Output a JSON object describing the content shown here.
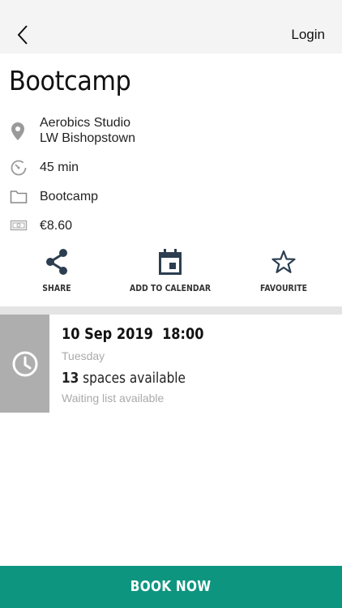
{
  "header": {
    "back_icon": "chevron-left-icon",
    "login_label": "Login"
  },
  "class": {
    "title": "Bootcamp",
    "location_line1": "Aerobics Studio",
    "location_line2": "LW Bishopstown",
    "duration": "45 min",
    "category": "Bootcamp",
    "price": "€8.60"
  },
  "icons": {
    "location": "location-pin-icon",
    "duration": "timer-icon",
    "category": "folder-icon",
    "price": "banknote-icon"
  },
  "actions": {
    "share_label": "SHARE",
    "calendar_label": "ADD TO CALENDAR",
    "favourite_label": "FAVOURITE"
  },
  "session": {
    "date": "10 Sep 2019",
    "time": "18:00",
    "day": "Tuesday",
    "spaces_count": "13",
    "spaces_label": "spaces available",
    "waiting": "Waiting list available",
    "icon": "clock-icon"
  },
  "footer": {
    "book_label": "BOOK NOW"
  },
  "colors": {
    "accent": "#0e9580",
    "side": "#aeaeae",
    "icon": "#2c3e50"
  }
}
